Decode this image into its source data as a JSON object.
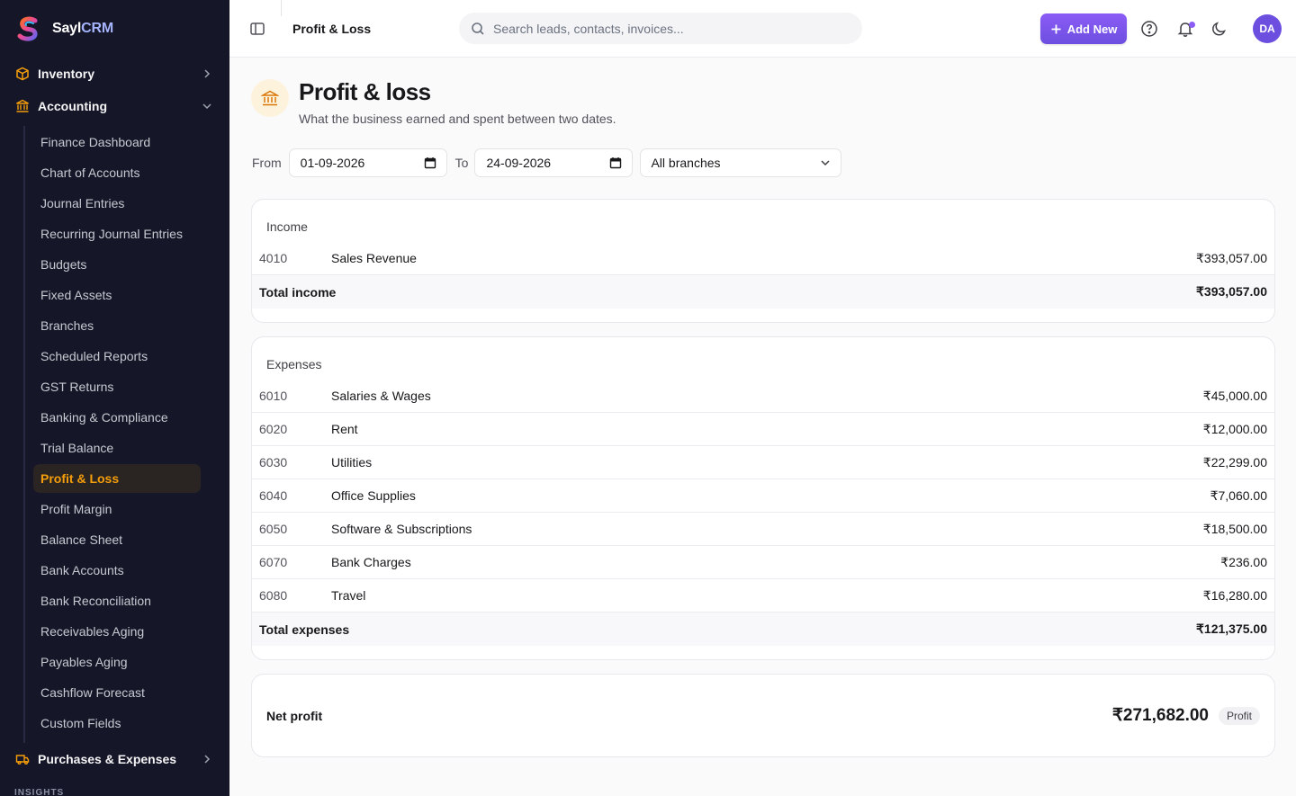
{
  "brand": {
    "name_part1": "Sayl",
    "name_part2": "CRM",
    "accent": "#a5b4fc"
  },
  "sidebar": {
    "groups": {
      "inventory": {
        "label": "Inventory",
        "icon": "box-icon"
      },
      "accounting": {
        "label": "Accounting",
        "icon": "bank-icon"
      },
      "purchases": {
        "label": "Purchases & Expenses",
        "icon": "truck-icon"
      }
    },
    "accounting_items": [
      "Finance Dashboard",
      "Chart of Accounts",
      "Journal Entries",
      "Recurring Journal Entries",
      "Budgets",
      "Fixed Assets",
      "Branches",
      "Scheduled Reports",
      "GST Returns",
      "Banking & Compliance",
      "Trial Balance",
      "Profit & Loss",
      "Profit Margin",
      "Balance Sheet",
      "Bank Accounts",
      "Bank Reconciliation",
      "Receivables Aging",
      "Payables Aging",
      "Cashflow Forecast",
      "Custom Fields"
    ],
    "active_item": "Profit & Loss",
    "section_label": "INSIGHTS"
  },
  "topbar": {
    "breadcrumb": "Profit & Loss",
    "search_placeholder": "Search leads, contacts, invoices...",
    "add_new_label": "Add New",
    "avatar_initials": "DA",
    "accent": "#6d4fe0"
  },
  "page": {
    "title": "Profit & loss",
    "subtitle": "What the business earned and spent between two dates."
  },
  "filters": {
    "from_label": "From",
    "from_value": "01-09-2026",
    "to_label": "To",
    "to_value": "24-09-2026",
    "branch_value": "All branches"
  },
  "income": {
    "title": "Income",
    "rows": [
      {
        "code": "4010",
        "name": "Sales Revenue",
        "amount": "₹393,057.00"
      }
    ],
    "total_label": "Total income",
    "total_amount": "₹393,057.00"
  },
  "expenses": {
    "title": "Expenses",
    "rows": [
      {
        "code": "6010",
        "name": "Salaries & Wages",
        "amount": "₹45,000.00"
      },
      {
        "code": "6020",
        "name": "Rent",
        "amount": "₹12,000.00"
      },
      {
        "code": "6030",
        "name": "Utilities",
        "amount": "₹22,299.00"
      },
      {
        "code": "6040",
        "name": "Office Supplies",
        "amount": "₹7,060.00"
      },
      {
        "code": "6050",
        "name": "Software & Subscriptions",
        "amount": "₹18,500.00"
      },
      {
        "code": "6070",
        "name": "Bank Charges",
        "amount": "₹236.00"
      },
      {
        "code": "6080",
        "name": "Travel",
        "amount": "₹16,280.00"
      }
    ],
    "total_label": "Total expenses",
    "total_amount": "₹121,375.00"
  },
  "net": {
    "label": "Net profit",
    "amount": "₹271,682.00",
    "badge": "Profit"
  }
}
